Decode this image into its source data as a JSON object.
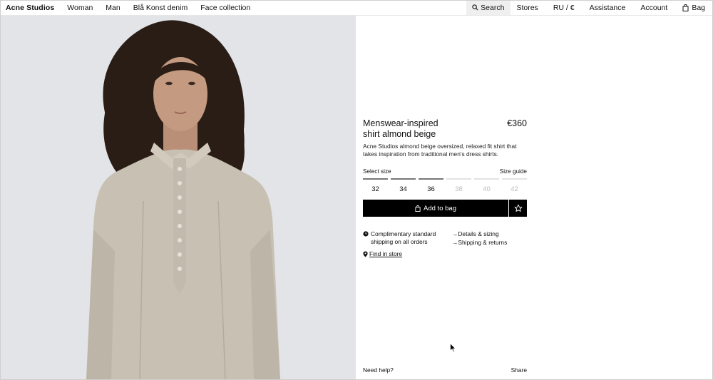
{
  "nav": {
    "brand": "Acne Studios",
    "links": [
      "Woman",
      "Man",
      "Blå Konst denim",
      "Face collection"
    ],
    "search_label": "Search",
    "stores_label": "Stores",
    "region_label": "RU / €",
    "assistance_label": "Assistance",
    "account_label": "Account",
    "bag_label": "Bag"
  },
  "product": {
    "title_line1": "Menswear-inspired",
    "title_line2": "shirt almond beige",
    "price": "€360",
    "description": "Acne Studios almond beige oversized, relaxed fit shirt that takes inspiration from traditional men's dress shirts.",
    "select_size_label": "Select size",
    "size_guide_label": "Size guide",
    "sizes": [
      {
        "label": "32",
        "available": true
      },
      {
        "label": "34",
        "available": true
      },
      {
        "label": "36",
        "available": true
      },
      {
        "label": "38",
        "available": false
      },
      {
        "label": "40",
        "available": false
      },
      {
        "label": "42",
        "available": false
      }
    ],
    "add_to_bag_label": "Add to bag",
    "shipping_line1": "Complimentary standard",
    "shipping_line2": "shipping on all orders",
    "details_label": "Details & sizing",
    "shipping_returns_label": "Shipping & returns",
    "find_in_store_label": "Find in store"
  },
  "footer": {
    "need_help_label": "Need help?",
    "share_label": "Share"
  },
  "icons": {
    "search": "search-icon",
    "bag": "bag-icon",
    "wishlist": "star-icon",
    "shipping": "clock-icon",
    "arrow": "arrow-right-icon",
    "location": "location-pin-icon"
  },
  "colors": {
    "button_bg": "#000000",
    "photo_bg": "#e3e4e8",
    "search_bg": "#efefef",
    "unavailable": "#bbbbbb"
  }
}
